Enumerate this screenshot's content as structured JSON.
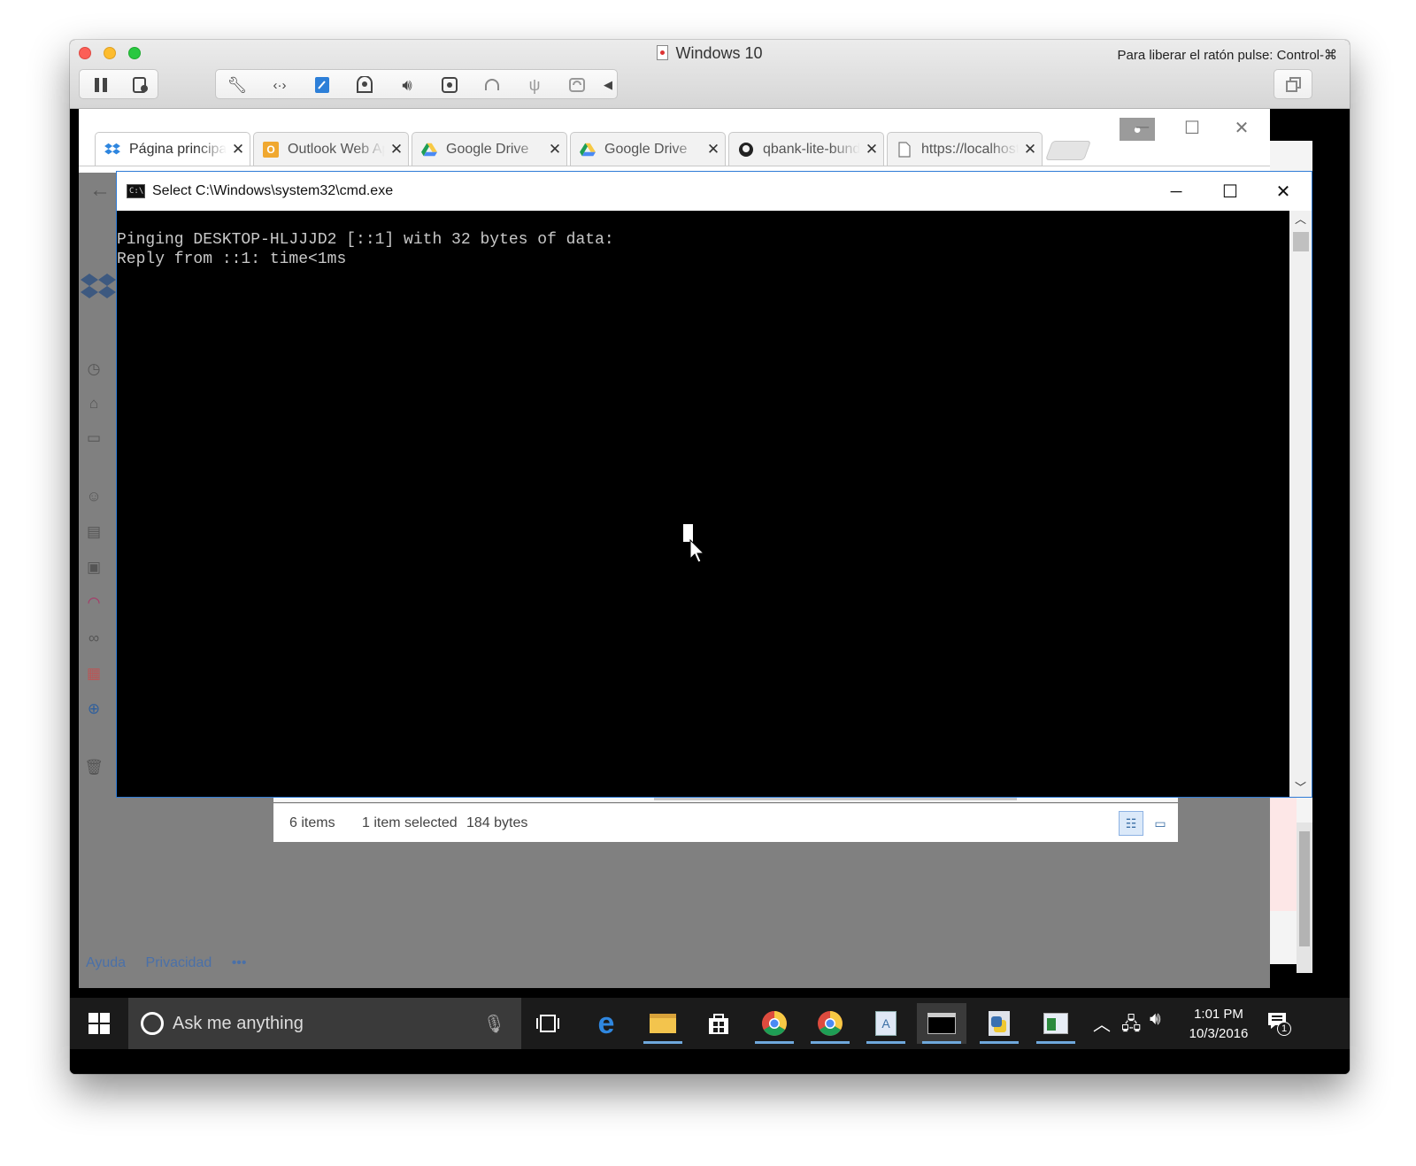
{
  "host": {
    "title": "Windows 10",
    "release_hint": "Para liberar el ratón pulse: Control-⌘",
    "toolbar_icons": [
      "pause-icon",
      "snapshot-icon",
      "wrench-icon",
      "network-icon",
      "drive-icon",
      "camera-icon",
      "speaker-icon",
      "disc-icon",
      "headphones-icon",
      "usb-icon",
      "sync-icon",
      "collapse-arrow-icon"
    ],
    "window_mode_icon": "window-restore-icon"
  },
  "browser": {
    "tabs": [
      {
        "title": "Página principal - Dropbox",
        "icon": "dropbox-icon",
        "active": true
      },
      {
        "title": "Outlook Web App",
        "icon": "outlook-icon",
        "active": false
      },
      {
        "title": "Google Drive",
        "icon": "google-drive-icon",
        "active": false
      },
      {
        "title": "Google Drive",
        "icon": "google-drive-icon",
        "active": false
      },
      {
        "title": "qbank-lite-bundle",
        "icon": "github-icon",
        "active": false
      },
      {
        "title": "https://localhost",
        "icon": "page-icon",
        "active": false
      }
    ],
    "footer_links": [
      "Ayuda",
      "Privacidad",
      "•••"
    ]
  },
  "explorer": {
    "items_count": "6 items",
    "selection": "1 item selected",
    "size": "184 bytes"
  },
  "cmd": {
    "title": "Select C:\\Windows\\system32\\cmd.exe",
    "lines": [
      "Pinging DESKTOP-HLJJJD2 [::1] with 32 bytes of data:",
      "Reply from ::1: time<1ms"
    ]
  },
  "taskbar": {
    "search_placeholder": "Ask me anything",
    "time": "1:01 PM",
    "date": "10/3/2016",
    "notification_count": "1"
  }
}
